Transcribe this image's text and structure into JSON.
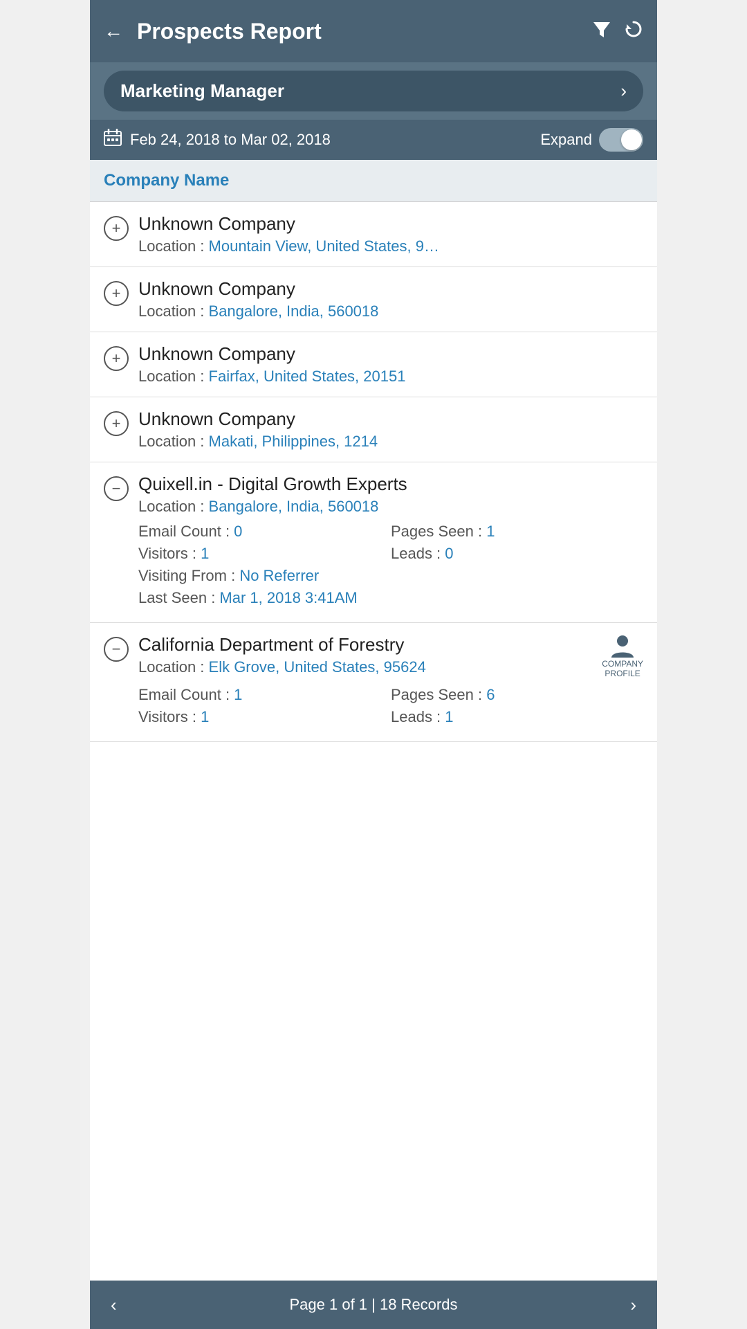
{
  "header": {
    "back_label": "‹",
    "title": "Prospects Report",
    "filter_icon": "filter-icon",
    "refresh_icon": "refresh-icon"
  },
  "role_selector": {
    "label": "Marketing Manager",
    "arrow": "›"
  },
  "date_bar": {
    "date_range": "Feb 24, 2018 to Mar 02, 2018",
    "expand_label": "Expand",
    "toggle_on": true
  },
  "column_header": {
    "label": "Company Name"
  },
  "companies": [
    {
      "id": 1,
      "name": "Unknown Company",
      "location": "Mountain View, United States, 9…",
      "expanded": false,
      "icon": "plus"
    },
    {
      "id": 2,
      "name": "Unknown Company",
      "location": "Bangalore, India, 560018",
      "expanded": false,
      "icon": "plus"
    },
    {
      "id": 3,
      "name": "Unknown Company",
      "location": "Fairfax, United States, 20151",
      "expanded": false,
      "icon": "plus"
    },
    {
      "id": 4,
      "name": "Unknown Company",
      "location": "Makati, Philippines, 1214",
      "expanded": false,
      "icon": "plus"
    },
    {
      "id": 5,
      "name": "Quixell.in - Digital Growth Experts",
      "location": "Bangalore, India, 560018",
      "expanded": true,
      "icon": "minus",
      "email_count": "0",
      "pages_seen": "1",
      "visitors": "1",
      "leads": "0",
      "visiting_from": "No Referrer",
      "last_seen": "Mar 1, 2018 3:41AM",
      "has_profile": false
    },
    {
      "id": 6,
      "name": "California Department of Forestry",
      "location": "Elk Grove, United States, 95624",
      "expanded": true,
      "icon": "minus",
      "email_count": "1",
      "pages_seen": "6",
      "visitors": "1",
      "leads": "1",
      "has_profile": true
    }
  ],
  "footer": {
    "prev_arrow": "‹",
    "next_arrow": "›",
    "page_info": "Page 1 of 1 | 18 Records"
  },
  "labels": {
    "location_prefix": "Location : ",
    "email_count_prefix": "Email Count : ",
    "pages_seen_prefix": "Pages Seen : ",
    "visitors_prefix": "Visitors : ",
    "leads_prefix": "Leads : ",
    "visiting_from_prefix": "Visiting From : ",
    "last_seen_prefix": "Last Seen : ",
    "company_profile_line1": "COMPANY",
    "company_profile_line2": "PROFILE"
  }
}
